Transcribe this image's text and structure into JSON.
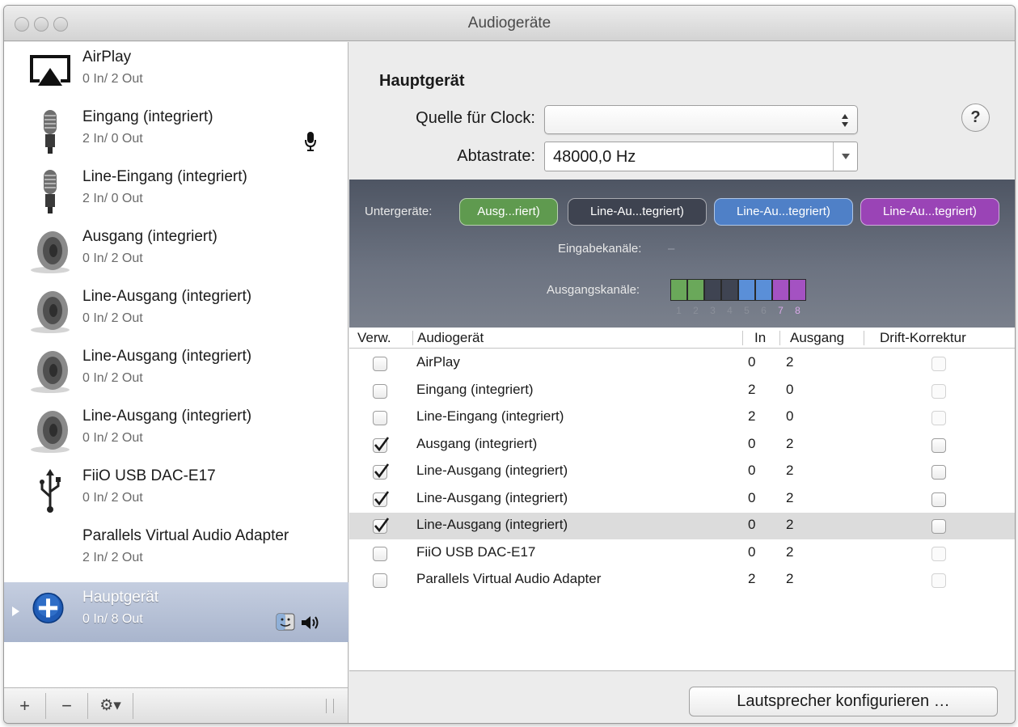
{
  "window": {
    "title": "Audiogeräte"
  },
  "sidebar": {
    "devices": [
      {
        "name": "AirPlay",
        "io": "0 In/ 2 Out",
        "icon": "airplay-icon"
      },
      {
        "name": "Eingang (integriert)",
        "io": "2 In/ 0 Out",
        "icon": "microphone-icon"
      },
      {
        "name": "Line-Eingang (integriert)",
        "io": "2 In/ 0 Out",
        "icon": "microphone-icon"
      },
      {
        "name": "Ausgang (integriert)",
        "io": "0 In/ 2 Out",
        "icon": "speaker-icon"
      },
      {
        "name": "Line-Ausgang (integriert)",
        "io": "0 In/ 2 Out",
        "icon": "speaker-icon"
      },
      {
        "name": "Line-Ausgang (integriert)",
        "io": "0 In/ 2 Out",
        "icon": "speaker-icon"
      },
      {
        "name": "Line-Ausgang (integriert)",
        "io": "0 In/ 2 Out",
        "icon": "speaker-icon"
      },
      {
        "name": "FiiO USB DAC-E17",
        "io": "0 In/ 2 Out",
        "icon": "usb-icon"
      },
      {
        "name": "Parallels Virtual Audio Adapter",
        "io": "2 In/ 2 Out",
        "icon": ""
      },
      {
        "name": "Hauptgerät",
        "io": "0 In/ 8 Out",
        "icon": "aggregate-device-icon",
        "selected": true
      }
    ],
    "footer": {
      "add": "+",
      "remove": "−",
      "gear": "⚙▾"
    }
  },
  "main": {
    "heading": "Hauptgerät",
    "clock_label": "Quelle für Clock:",
    "clock_value": "",
    "rate_label": "Abtastrate:",
    "rate_value": "48000,0 Hz",
    "help": "?",
    "subdevices": {
      "label": "Untergeräte:",
      "pills": [
        {
          "text": "Ausg...riert)",
          "color": "#5f9a4f"
        },
        {
          "text": "Line-Au...tegriert)",
          "color": "#3e4350"
        },
        {
          "text": "Line-Au...tegriert)",
          "color": "#4f80c7"
        },
        {
          "text": "Line-Au...tegriert)",
          "color": "#9a44b6"
        }
      ],
      "input_label": "Eingabekanäle:",
      "input_value": "–",
      "output_label": "Ausgangskanäle:",
      "output_channels": [
        {
          "num": "1",
          "color": "#6aa85a"
        },
        {
          "num": "2",
          "color": "#6aa85a"
        },
        {
          "num": "3",
          "color": "#3f4452"
        },
        {
          "num": "4",
          "color": "#3f4452"
        },
        {
          "num": "5",
          "color": "#5a8fd8"
        },
        {
          "num": "6",
          "color": "#5a8fd8"
        },
        {
          "num": "7",
          "color": "#a452c2"
        },
        {
          "num": "8",
          "color": "#a452c2"
        }
      ]
    },
    "table": {
      "headers": {
        "use": "Verw.",
        "device": "Audiogerät",
        "in": "In",
        "out": "Ausgang",
        "drift": "Drift-Korrektur"
      },
      "rows": [
        {
          "use": false,
          "device": "AirPlay",
          "in": "0",
          "out": "2",
          "drift": false,
          "drift_enabled": false
        },
        {
          "use": false,
          "device": "Eingang (integriert)",
          "in": "2",
          "out": "0",
          "drift": false,
          "drift_enabled": false
        },
        {
          "use": false,
          "device": "Line-Eingang (integriert)",
          "in": "2",
          "out": "0",
          "drift": false,
          "drift_enabled": false
        },
        {
          "use": true,
          "device": "Ausgang (integriert)",
          "in": "0",
          "out": "2",
          "drift": false,
          "drift_enabled": true
        },
        {
          "use": true,
          "device": "Line-Ausgang (integriert)",
          "in": "0",
          "out": "2",
          "drift": false,
          "drift_enabled": true
        },
        {
          "use": true,
          "device": "Line-Ausgang (integriert)",
          "in": "0",
          "out": "2",
          "drift": false,
          "drift_enabled": true
        },
        {
          "use": true,
          "device": "Line-Ausgang (integriert)",
          "in": "0",
          "out": "2",
          "drift": false,
          "drift_enabled": true,
          "highlighted": true
        },
        {
          "use": false,
          "device": "FiiO USB DAC-E17",
          "in": "0",
          "out": "2",
          "drift": false,
          "drift_enabled": false
        },
        {
          "use": false,
          "device": "Parallels Virtual Audio Adapter",
          "in": "2",
          "out": "2",
          "drift": false,
          "drift_enabled": false
        }
      ]
    },
    "configure_button": "Lautsprecher konfigurieren …"
  }
}
